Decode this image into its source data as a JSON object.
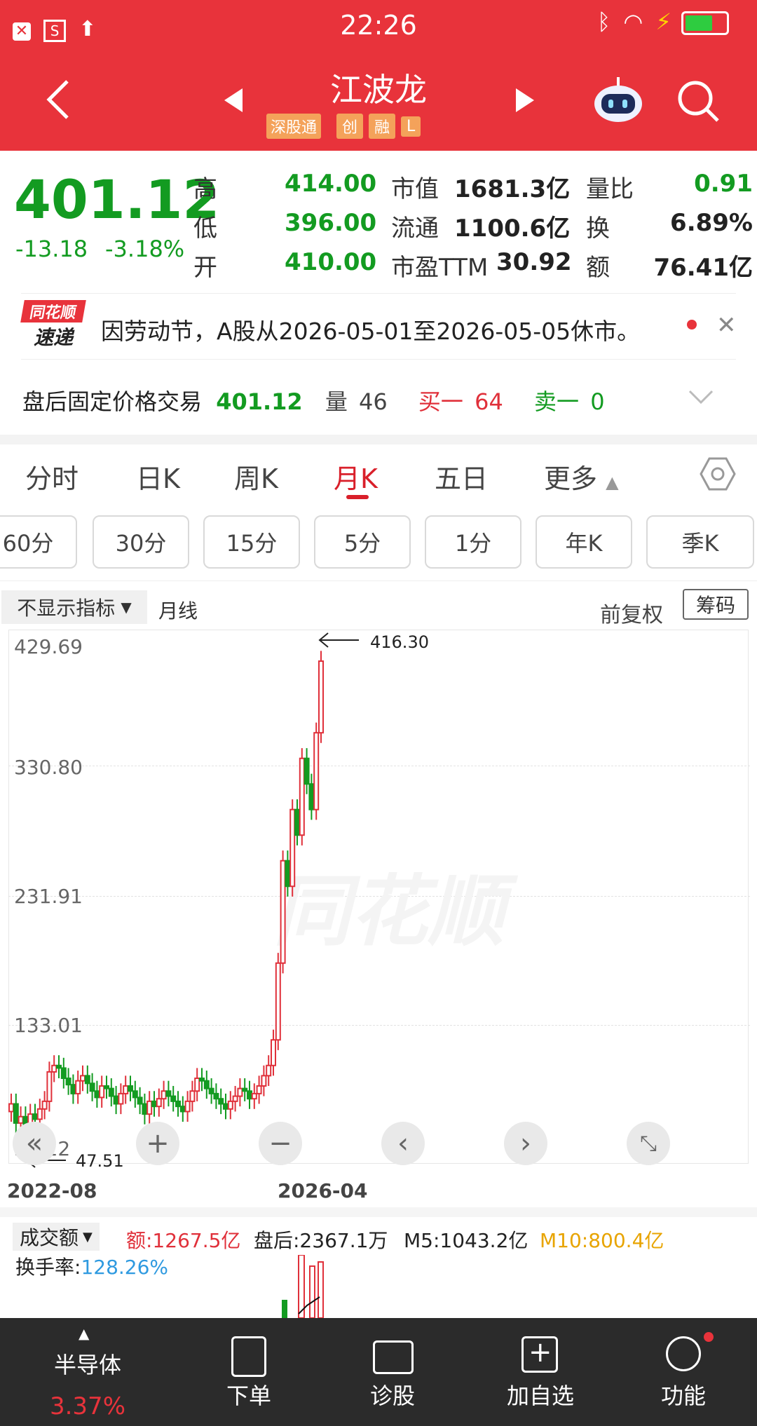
{
  "status_bar": {
    "time": "22:26"
  },
  "header": {
    "title": "江波龙",
    "tags": [
      "深股通",
      "创",
      "融",
      "L"
    ]
  },
  "quote": {
    "price": "401.12",
    "change": "-13.18",
    "change_pct": "-3.18%",
    "rows": [
      [
        "高",
        "414.00",
        "市值",
        "1681.3亿",
        "量比",
        "0.91"
      ],
      [
        "低",
        "396.00",
        "流通",
        "1100.6亿",
        "换",
        "6.89%"
      ],
      [
        "开",
        "410.00",
        "市盈TTM",
        "30.92",
        "额",
        "76.41亿"
      ]
    ]
  },
  "notice": {
    "badge_top": "同花顺",
    "badge_bottom": "速递",
    "text": "因劳动节，A股从2026-05-01至2026-05-05休市。"
  },
  "after_hours": {
    "label": "盘后固定价格交易",
    "price": "401.12",
    "vol_label": "量",
    "vol": "46",
    "buy_label": "买一",
    "buy": "64",
    "sell_label": "卖一",
    "sell": "0"
  },
  "tabs": [
    "分时",
    "日K",
    "周K",
    "月K",
    "五日",
    "更多"
  ],
  "active_tab": "月K",
  "periods": [
    "60分",
    "30分",
    "15分",
    "5分",
    "1分",
    "年K",
    "季K"
  ],
  "chart_toolbar": {
    "indicator": "不显示指标",
    "line_type": "月线",
    "adjust": "前复权",
    "chips": "筹码"
  },
  "chart_data": {
    "type": "candlestick",
    "y_ticks": [
      "429.69",
      "330.80",
      "231.91",
      "133.01",
      "34.12"
    ],
    "x_labels": [
      "2022-08",
      "2026-04"
    ],
    "max_annotation": "416.30",
    "min_annotation": "47.51",
    "colors": {
      "up": "#e0303a",
      "down": "#139b21"
    }
  },
  "volume": {
    "label": "成交额",
    "amount": "额:1267.5亿",
    "after_hours": "盘后:2367.1万",
    "m5": "M5:1043.2亿",
    "m10": "M10:800.4亿",
    "turnover_label": "换手率:",
    "turnover": "128.26%"
  },
  "bottom_nav": {
    "sector": "半导体",
    "sector_change": "3.37%",
    "items": [
      "下单",
      "诊股",
      "加自选",
      "功能"
    ]
  }
}
